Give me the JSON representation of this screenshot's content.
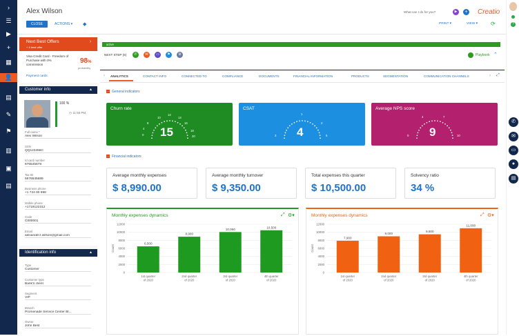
{
  "header": {
    "title": "Alex Wilson",
    "close_label": "CLOSE",
    "actions_label": "ACTIONS",
    "search_placeholder": "What can I do for you?",
    "brand": "Creatio",
    "print_label": "PRINT",
    "view_label": "VIEW"
  },
  "offers": {
    "title": "Next Best Offers",
    "subtitle": "+ 4 best offer",
    "item": "Visa Credit Card - Freedom of Purchase with 0% commission",
    "percent": "98",
    "percent_sign": "%",
    "probability_label": "probability",
    "payment_cards": "Payment cards"
  },
  "customer_info": {
    "title": "Customer info",
    "completeness": "100 %",
    "time": "11:55 PM,",
    "fields": [
      {
        "label": "Full name *",
        "value": "Alex Wilson"
      },
      {
        "label": "SSN",
        "value": "QQ123456C"
      },
      {
        "label": "Id card number",
        "value": "876545678"
      },
      {
        "label": "Tax ID",
        "value": "5676545689"
      },
      {
        "label": "Business phone",
        "value": "+1 724 00 998",
        "link": true
      },
      {
        "label": "Mobile phone",
        "value": "+1719122312",
        "link": true
      },
      {
        "label": "Code",
        "value": "C000001"
      },
      {
        "label": "Email",
        "value": "alexander.t.wilson@gmail.com",
        "link": true
      }
    ]
  },
  "identification_info": {
    "title": "Identification info",
    "fields": [
      {
        "label": "Type",
        "value": "Customer"
      },
      {
        "label": "Customer type",
        "value": "Bank's client"
      },
      {
        "label": "Segment",
        "value": "VIP"
      },
      {
        "label": "Branch",
        "value": "Promenade Service Center Br...",
        "link": true
      },
      {
        "label": "Owner",
        "value": "John Best",
        "link": true
      }
    ]
  },
  "stage": {
    "label": "active"
  },
  "next_step": {
    "label": "NEXT STEP (5)",
    "playbook": "Playbook"
  },
  "tabs": [
    "ANALYTICS",
    "CONTACT INFO",
    "CONNECTED TO",
    "COMPLIANCE",
    "DOCUMENTS",
    "FINANCIAL INFORMATION",
    "PRODUCTS",
    "SEGMENTATION",
    "COMMUNICATION CHANNELS"
  ],
  "sections": {
    "general": "General indicators",
    "financial": "Financial indicators"
  },
  "gauges": [
    {
      "title": "Churn rate",
      "value": "15",
      "ticks": [
        "0",
        "4",
        "8",
        "10",
        "12",
        "14",
        "16",
        "18",
        "20"
      ],
      "color": "#1e8c23"
    },
    {
      "title": "CSAT",
      "value": "4",
      "ticks": [
        "3",
        "1",
        "2",
        "5"
      ],
      "color": "#1d8fe0"
    },
    {
      "title": "Average NPS score",
      "value": "9",
      "ticks": [
        "0",
        "4",
        "7",
        "10"
      ],
      "color": "#b3216e"
    }
  ],
  "kpis": [
    {
      "title": "Average monthly expenses",
      "value": "$ 8,990.00"
    },
    {
      "title": "Average monthly turnover",
      "value": "$ 9,350.00"
    },
    {
      "title": "Total expenses this quarter",
      "value": "$ 10,500.00"
    },
    {
      "title": "Solvency ratio",
      "value": "34 %"
    }
  ],
  "chart_data": [
    {
      "type": "bar",
      "title": "Monthly expenses dynamics",
      "ylabel": "Count",
      "categories": [
        "1st quarter of 2020",
        "2nd quarter of 2020",
        "3rd quarter of 2020",
        "4th quarter of 2020"
      ],
      "values": [
        6500,
        8900,
        10060,
        10500
      ],
      "value_labels": [
        "6,500",
        "8,900",
        "10,060",
        "10,500"
      ],
      "ylim": [
        0,
        12000
      ],
      "yticks": [
        "0",
        "2000",
        "4000",
        "6000",
        "8000",
        "10000",
        "12000"
      ],
      "color": "#1e9a21",
      "grid": true
    },
    {
      "type": "bar",
      "title": "Monthly expenses dynamics",
      "ylabel": "Count",
      "categories": [
        "1st quarter of 2020",
        "2nd quarter of 2020",
        "3rd quarter of 2020",
        "4th quarter of 2020"
      ],
      "values": [
        7900,
        9000,
        9500,
        11000
      ],
      "value_labels": [
        "7,900",
        "9,000",
        "9,500",
        "11,000"
      ],
      "ylim": [
        0,
        12000
      ],
      "yticks": [
        "0",
        "2000",
        "4000",
        "6000",
        "8000",
        "10000",
        "12000"
      ],
      "color": "#f06212",
      "grid": true
    }
  ]
}
